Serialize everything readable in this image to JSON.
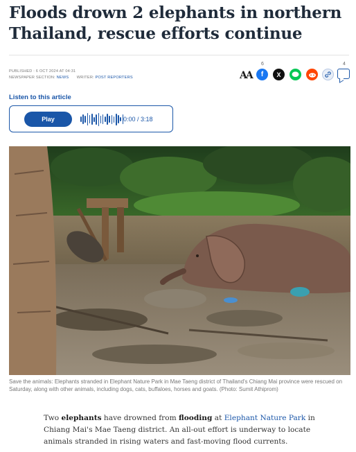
{
  "article": {
    "headline_line1": "Floods drown 2 elephants in northern",
    "headline_line2": "Thailand, rescue efforts continue",
    "published_label": "PUBLISHED : 6 OCT 2024 AT 04:31",
    "section_label": "NEWSPAPER SECTION:",
    "section_value": "NEWS",
    "writer_label": "WRITER:",
    "writer_value": "POST REPORTERS"
  },
  "share": {
    "text_size_label": "AA",
    "facebook_count": "6",
    "comment_count": "4",
    "icons": [
      "text-size-icon",
      "facebook-icon",
      "x-icon",
      "line-icon",
      "reddit-icon",
      "link-icon",
      "comment-icon"
    ],
    "colors": {
      "facebook": "#1877f2",
      "x": "#111111",
      "line": "#06c755",
      "reddit": "#ff4500",
      "link": "#e8eef7",
      "accent": "#1a56a8"
    }
  },
  "audio": {
    "listen_label": "Listen to this article",
    "play_label": "Play",
    "time_label": "0:00 / 3:18"
  },
  "image": {
    "caption": "Save the animals: Elephants stranded in Elephant Nature Park in Mae Taeng district of Thailand's Chiang Mai province were rescued on Saturday, along with other animals, including dogs, cats, buffaloes, horses and goats. (Photo: Sumit Athiprom)"
  },
  "body": {
    "p1_a": "Two ",
    "p1_b": "elephants",
    "p1_c": " have drowned from ",
    "p1_d": "flooding",
    "p1_e": " at ",
    "p1_link": "Elephant Nature Park",
    "p1_f": " in Chiang Mai's Mae Taeng district. An all-out effort is underway to locate animals stranded in rising waters and fast-moving flood currents."
  }
}
